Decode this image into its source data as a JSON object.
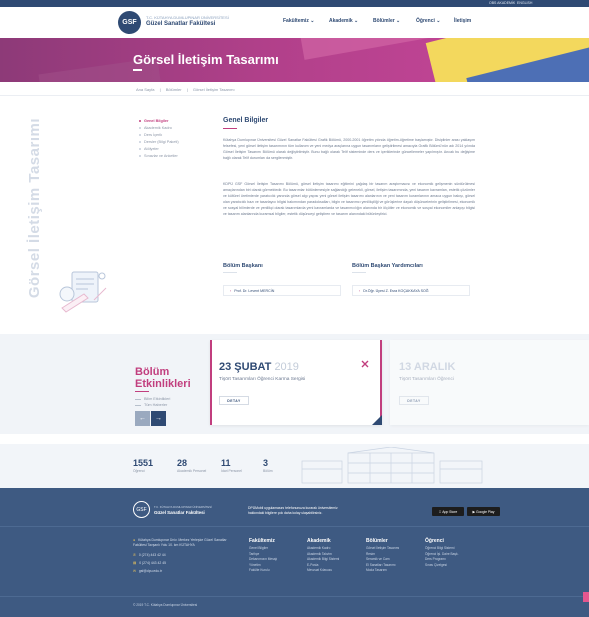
{
  "topbar": {
    "links": [
      "OBS AKADEMİK",
      "ENGLISH"
    ]
  },
  "header": {
    "logo_mark": "GSF",
    "university": "T.C. KÜTAHYA DUMLUPINAR ÜNİVERSİTESİ",
    "faculty": "Güzel Sanatlar Fakültesi",
    "nav": [
      "Fakültemiz ⌄",
      "Akademik ⌄",
      "Bölümler ⌄",
      "Öğrenci ⌄",
      "İletişim"
    ]
  },
  "hero": {
    "title": "Görsel İletişim Tasarımı"
  },
  "breadcrumb": [
    "Ana Sayfa",
    "Bölümler",
    "Görsel İletişim Tasarımı"
  ],
  "vertical_title": "Görsel İletişim Tasarımı",
  "sidebar": {
    "items": [
      {
        "label": "Genel Bilgiler",
        "active": true
      },
      {
        "label": "Akademik Kadro",
        "active": false
      },
      {
        "label": "Ders İçerik",
        "active": false
      },
      {
        "label": "Dersler (Bilgi Paketi)",
        "active": false
      },
      {
        "label": "Atölyeler",
        "active": false
      },
      {
        "label": "Sınavlar ve Anketler",
        "active": false
      }
    ]
  },
  "main": {
    "heading": "Genel Bilgiler",
    "paragraphs": [
      "Kütahya Dumlupınar Üniversitesi Güzel Sanatlar Fakültesi Grafik Bölümü, 2000-2001 öğretim yılında öğretim-öğretime başlamıştır. Disiplinler arası yaklaşım felsefesi, yeni görsel iletişim tasarımının tüm kullanım ve yeni medya araçlarına uygun tasarımların geliştirilmesi amacıyla Grafik Bölümü'nün adı 2014 yılında Görsel İletişim Tasarımı Bölümü olarak değiştirilmiştir. Bunu bağlı olarak Telif sisteminde ders ve içeriklerinde güncellemeler yapılmıştır. Ancak bu değişime bağlı olarak Telif durumları da sergilenmiştir.",
      "KDPÜ GSF Görsel İletişim Tasarımı Bölümü, görsel iletişim tasarımı eğitimini çağdaş bir tasarım araştırmacısı ve ekonomik gelişmenin sürdürülmesi amaçlarından biri olarak görmektedir. Bu tasarımlar bütünlemesiyle sağlandığı gelenekli, görsel, iletişim tasarımında, yeni tasarım kavramları, estetik çözümler ve kültürel üretimlerde yaratıcılık yanında görsel algı yapısı yeni görsel iletişim tasarımı alanlarının ve yeni tasarım kuramlarının amaca uygun bakışı, görsel olan yaratıcılık bazı ve tasarlayıcı bilgisi bakımından paradoksalları, bilgin ve tasarımcı yenilikçiliği ve görüşlerine dayalı düşüncelerinin geliştirilmesi, ekonomik ve sosyal bilimlerde ve yenilikçi olarak tasarımlarda yeni kavramlarda ve tasarımcılığın alanında bir ölçütler ve ekonomik ve sosyal ekonomiler anlayışı bilgisi ve tasarım alanlarında kuramsal bilgiler, estetik düşünceyi geliştiren ve tasarım alanındaki bütünleştirici."
    ]
  },
  "people": {
    "head": {
      "title": "Bölüm Başkanı",
      "name": "Prof. Dr. Levent MERCİN"
    },
    "deputy": {
      "title": "Bölüm Başkan Yardımcıları",
      "name": "Dr.Öğr. Üyesi Z. Esra KOÇAKKAYA SOĞ"
    }
  },
  "events": {
    "heading_line1": "Bölüm",
    "heading_line2": "Etkinlikleri",
    "links": [
      "Bilim Etkinlikleri",
      "Tüm Haberler"
    ],
    "prev_icon": "←",
    "next_icon": "→",
    "cards": [
      {
        "day": "23 ŞUBAT",
        "year": "2019",
        "title": "Tişört Tasarımları Öğrenci Karma Sergisi",
        "button": "DETAY"
      },
      {
        "day": "13 ARALIK",
        "year": "",
        "title": "Tişört Tasarımları Öğrenci",
        "button": "DETAY"
      }
    ]
  },
  "stats": [
    {
      "number": "1551",
      "label": "Öğrenci"
    },
    {
      "number": "28",
      "label": "Akademik Personel"
    },
    {
      "number": "11",
      "label": "İdari Personel"
    },
    {
      "number": "3",
      "label": "Bölüm"
    }
  ],
  "footer": {
    "logo_mark": "GSF",
    "university": "T.C. KÜTAHYA DUMLUPINAR ÜNİVERSİTESİ",
    "faculty": "Güzel Sanatlar Fakültesi",
    "app_text": "DPÜMobil uygulamasını telefonunuza kurarak üniversitemiz hakkındaki bilgilere çok daha kolay ulaşabilirsiniz.",
    "stores": [
      "App Store",
      "Google Play"
    ],
    "contact": [
      "Kütahya Dumlupınar Üniv. Merkez Yerleşke Güzel Sanatlar Fakültesi Tavşanlı Yolu 10. km KÜTAHYA",
      "0 (274) 443 42 44",
      "0 (274) 443 42 45",
      "gsf@dpu.edu.tr"
    ],
    "columns": [
      {
        "title": "Fakültemiz",
        "items": [
          "Genel Bilgiler",
          "Tarihçe",
          "Dekanımızın Mesajı",
          "Yönetim",
          "Fakülte Kurulu"
        ]
      },
      {
        "title": "Akademik",
        "items": [
          "Akademik Kadro",
          "Akademik Takvim",
          "Akademik Bilgi Sistemi",
          "E-Posta",
          "Mevzuat Kılavuzu"
        ]
      },
      {
        "title": "Bölümler",
        "items": [
          "Görsel İletişim Tasarımı",
          "Resim",
          "Seramik ve Cam",
          "El Sanatları Tasarımı",
          "Moda Tasarımı"
        ]
      },
      {
        "title": "Öğrenci",
        "items": [
          "Öğrenci Bilgi Sistemi",
          "Öğrenci İşl. Daire Başk.",
          "Ders Programı",
          "Sınav Çizelgesi"
        ]
      }
    ],
    "copyright": "© 2019 T.C. Kütahya Dumlupınar Üniversitesi"
  },
  "colors": {
    "brand_navy": "#2f4a73",
    "accent_pink": "#c13e7e",
    "footer_bg": "#3e5a82"
  }
}
